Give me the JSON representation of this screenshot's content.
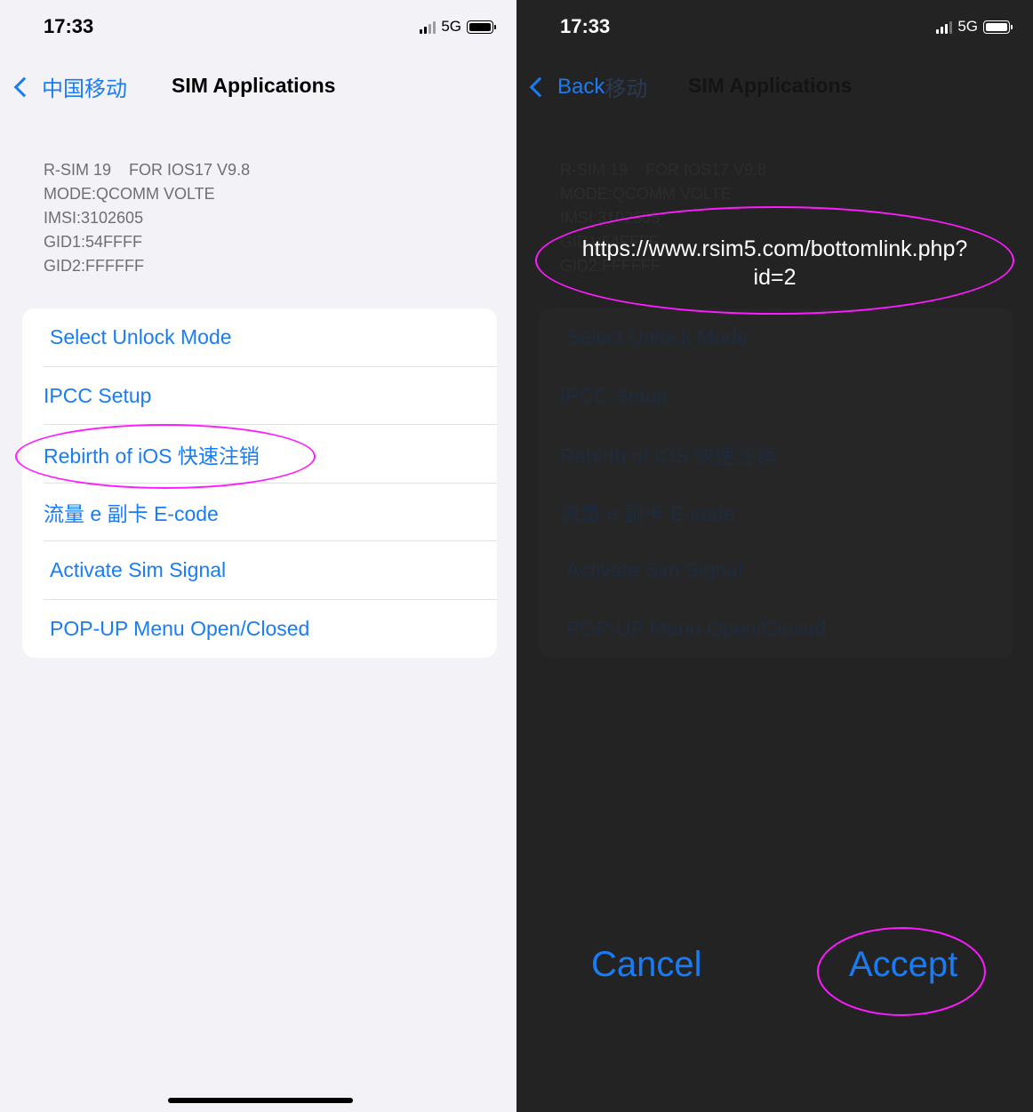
{
  "left_screen": {
    "status_bar": {
      "time": "17:33",
      "network": "5G"
    },
    "nav": {
      "back_label": "中国移动",
      "title": "SIM Applications"
    },
    "info_lines": [
      "R-SIM 19    FOR IOS17 V9.8",
      "MODE:QCOMM VOLTE",
      "IMSI:3102605",
      "GID1:54FFFF",
      "GID2:FFFFFF"
    ],
    "menu_items": [
      "Select Unlock Mode",
      "IPCC Setup",
      "Rebirth of iOS 快速注销",
      "流量 e 副卡 E-code",
      "Activate Sim Signal",
      "POP-UP Menu Open/Closed"
    ]
  },
  "right_screen": {
    "status_bar": {
      "time": "17:33",
      "network": "5G"
    },
    "nav": {
      "back_label": "Back",
      "back_ghost": "移动",
      "title": "SIM Applications"
    },
    "alert": {
      "url_line1": "https://www.rsim5.com/bottomlink.php?",
      "url_line2": "id=2",
      "cancel_label": "Cancel",
      "accept_label": "Accept"
    }
  },
  "colors": {
    "accent": "#1a7cf5",
    "annotation": "#ff1bff",
    "light_bg": "#f2f2f7",
    "dark_bg": "#232323"
  }
}
